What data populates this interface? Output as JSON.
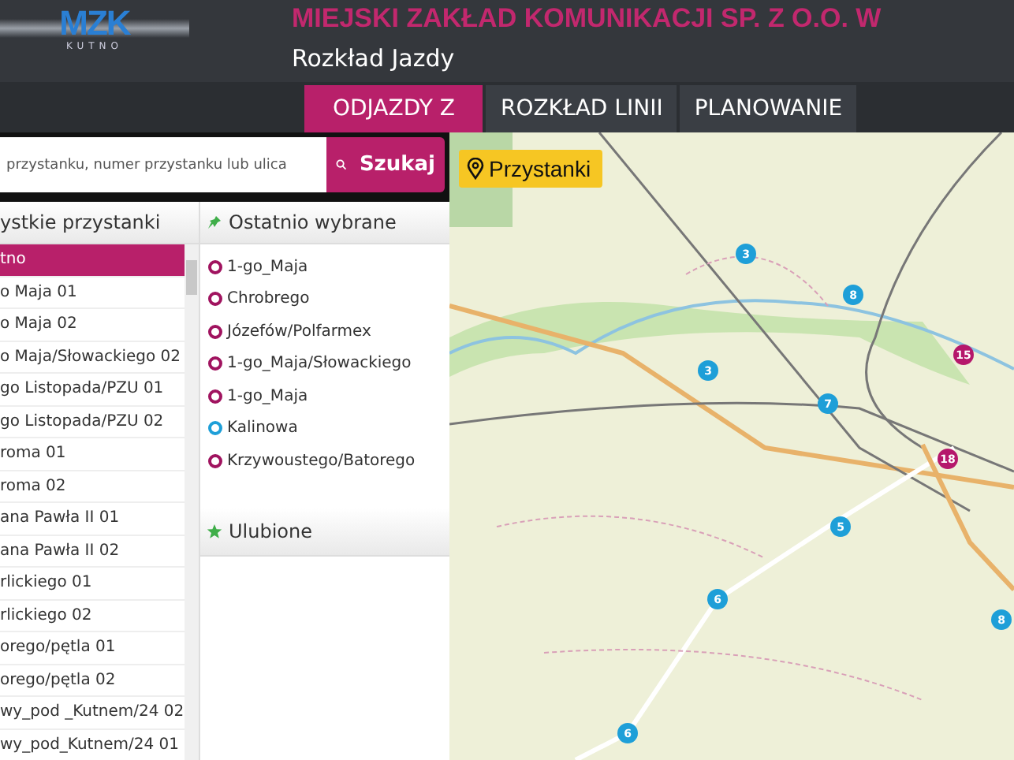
{
  "header": {
    "logo": "MZK",
    "logo_sub": "KUTNO",
    "title": "MIEJSKI ZAKŁAD KOMUNIKACJI SP. Z O.O. W",
    "subtitle": "Rozkład Jazdy"
  },
  "tabs": [
    {
      "label": "ODJAZDY Z",
      "selected": true
    },
    {
      "label": "ROZKŁAD LINII",
      "selected": false
    },
    {
      "label": "PLANOWANIE",
      "selected": false
    }
  ],
  "search": {
    "placeholder": "przystanku, numer przystanku lub ulica",
    "button": "Szukaj"
  },
  "all_stops": {
    "title": "ystkie przystanki",
    "items": [
      {
        "label": "tno",
        "selected": true
      },
      {
        "label": "o Maja 01",
        "selected": false
      },
      {
        "label": "o Maja 02",
        "selected": false
      },
      {
        "label": "o Maja/Słowackiego 02",
        "selected": false
      },
      {
        "label": "go Listopada/PZU 01",
        "selected": false
      },
      {
        "label": "go Listopada/PZU 02",
        "selected": false
      },
      {
        "label": "roma 01",
        "selected": false
      },
      {
        "label": "roma 02",
        "selected": false
      },
      {
        "label": "ana Pawła II 01",
        "selected": false
      },
      {
        "label": "ana Pawła II 02",
        "selected": false
      },
      {
        "label": "rlickiego 01",
        "selected": false
      },
      {
        "label": "rlickiego 02",
        "selected": false
      },
      {
        "label": "orego/pętla 01",
        "selected": false
      },
      {
        "label": "orego/pętla 02",
        "selected": false
      },
      {
        "label": "wy_pod _Kutnem/24 02",
        "selected": false
      },
      {
        "label": "wy_pod_Kutnem/24 01",
        "selected": false
      }
    ]
  },
  "recent": {
    "title": "Ostatnio wybrane",
    "items": [
      {
        "label": "1-go_Maja",
        "color": "#a0135f"
      },
      {
        "label": "Chrobrego",
        "color": "#a0135f"
      },
      {
        "label": "Józefów/Polfarmex",
        "color": "#a0135f"
      },
      {
        "label": "1-go_Maja/Słowackiego",
        "color": "#a0135f"
      },
      {
        "label": "1-go_Maja",
        "color": "#a0135f"
      },
      {
        "label": "Kalinowa",
        "color": "#1e9fd8"
      },
      {
        "label": "Krzywoustego/Batorego",
        "color": "#a0135f"
      }
    ]
  },
  "favorites": {
    "title": "Ulubione"
  },
  "map": {
    "badge": "Przystanki",
    "markers": [
      {
        "count": "3",
        "color": "#1e9fd8"
      },
      {
        "count": "8",
        "color": "#1e9fd8"
      },
      {
        "count": "15",
        "color": "#b5176b"
      },
      {
        "count": "3",
        "color": "#1e9fd8"
      },
      {
        "count": "7",
        "color": "#1e9fd8"
      },
      {
        "count": "18",
        "color": "#b5176b"
      },
      {
        "count": "5",
        "color": "#1e9fd8"
      },
      {
        "count": "6",
        "color": "#1e9fd8"
      },
      {
        "count": "8",
        "color": "#1e9fd8"
      },
      {
        "count": "6",
        "color": "#1e9fd8"
      }
    ]
  }
}
